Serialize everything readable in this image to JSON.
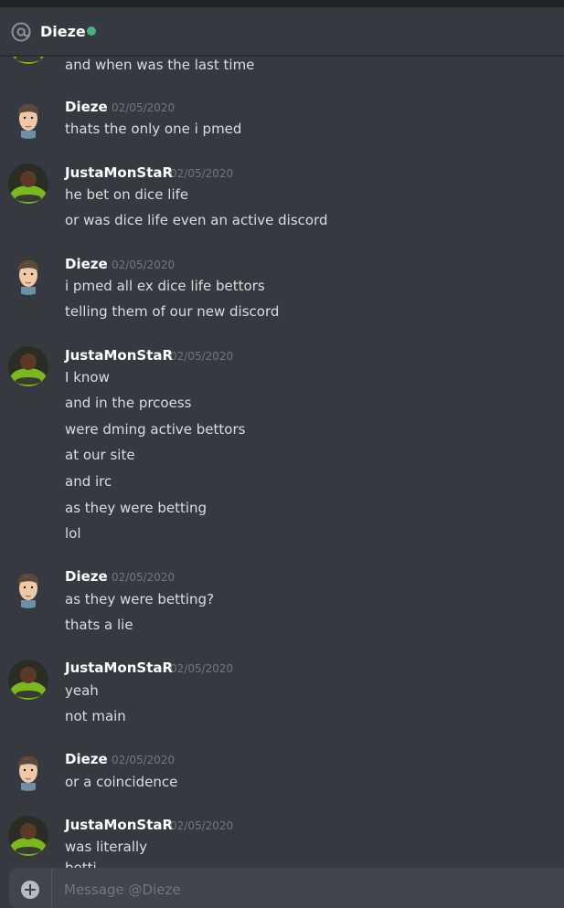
{
  "header": {
    "name": "Dieze",
    "status": "online",
    "status_color": "#43b581",
    "icon": "at-icon"
  },
  "messages": [
    {
      "author": "",
      "timestamp": "",
      "lines": [
        "and when was the last time"
      ],
      "avatar": "justamonstar-avatar"
    },
    {
      "author": "Dieze",
      "timestamp": "02/05/2020",
      "lines": [
        "thats the only one i pmed"
      ],
      "avatar": "dieze-avatar"
    },
    {
      "author": "JustaMonStaR",
      "timestamp": "02/05/2020",
      "lines": [
        "he bet on dice life",
        "or was dice life even an active discord"
      ],
      "avatar": "justamonstar-avatar"
    },
    {
      "author": "Dieze",
      "timestamp": "02/05/2020",
      "lines": [
        "i pmed all ex dice life bettors",
        "telling them of our new discord"
      ],
      "avatar": "dieze-avatar"
    },
    {
      "author": "JustaMonStaR",
      "timestamp": "02/05/2020",
      "lines": [
        "I know",
        "and in the prcoess",
        "were dming active bettors",
        "at our site",
        "and irc",
        "as they were betting",
        "lol"
      ],
      "avatar": "justamonstar-avatar"
    },
    {
      "author": "Dieze",
      "timestamp": "02/05/2020",
      "lines": [
        "as they were betting?",
        "thats a lie"
      ],
      "avatar": "dieze-avatar"
    },
    {
      "author": "JustaMonStaR",
      "timestamp": "02/05/2020",
      "lines": [
        "yeah",
        "not main"
      ],
      "avatar": "justamonstar-avatar"
    },
    {
      "author": "Dieze",
      "timestamp": "02/05/2020",
      "lines": [
        "or a coincidence"
      ],
      "avatar": "dieze-avatar"
    },
    {
      "author": "JustaMonStaR",
      "timestamp": "02/05/2020",
      "lines": [
        "was literally",
        "betti"
      ],
      "avatar": "justamonstar-avatar"
    }
  ],
  "composer": {
    "placeholder": "Message @Dieze",
    "value": "",
    "icon": "plus-circle-icon"
  },
  "colors": {
    "background": "#36393f",
    "author": "#ffffff",
    "text": "#dcddde",
    "muted": "#72767d",
    "input_bg": "#40444b"
  }
}
